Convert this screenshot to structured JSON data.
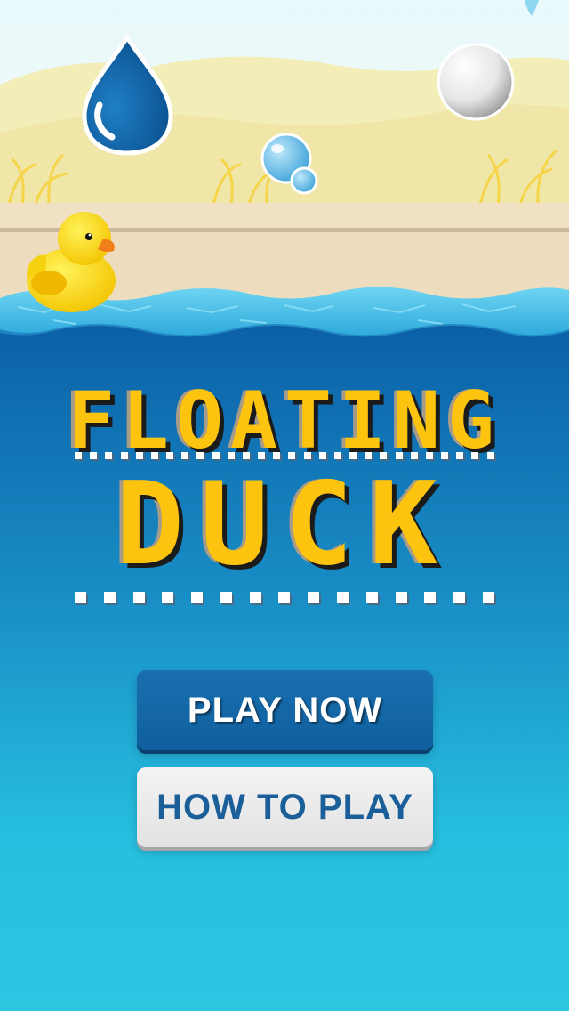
{
  "game": {
    "title_line1": "FLOATING",
    "title_line2": "DUCK"
  },
  "menu": {
    "play_label": "PLAY NOW",
    "how_to_play_label": "HOW TO PLAY"
  },
  "colors": {
    "sky": "#eaf8fb",
    "sand_hill": "#f2ecb4",
    "shore": "#efe0c2",
    "water_deep": "#0b5ea6",
    "water_light": "#2cc6e1",
    "title_yellow": "#fcc40f",
    "button_blue": "#15669f",
    "button_gray": "#e6e6e6"
  },
  "icons": [
    "water-drop-icon",
    "pearl-icon",
    "bubble-icon",
    "rubber-duck-icon"
  ]
}
